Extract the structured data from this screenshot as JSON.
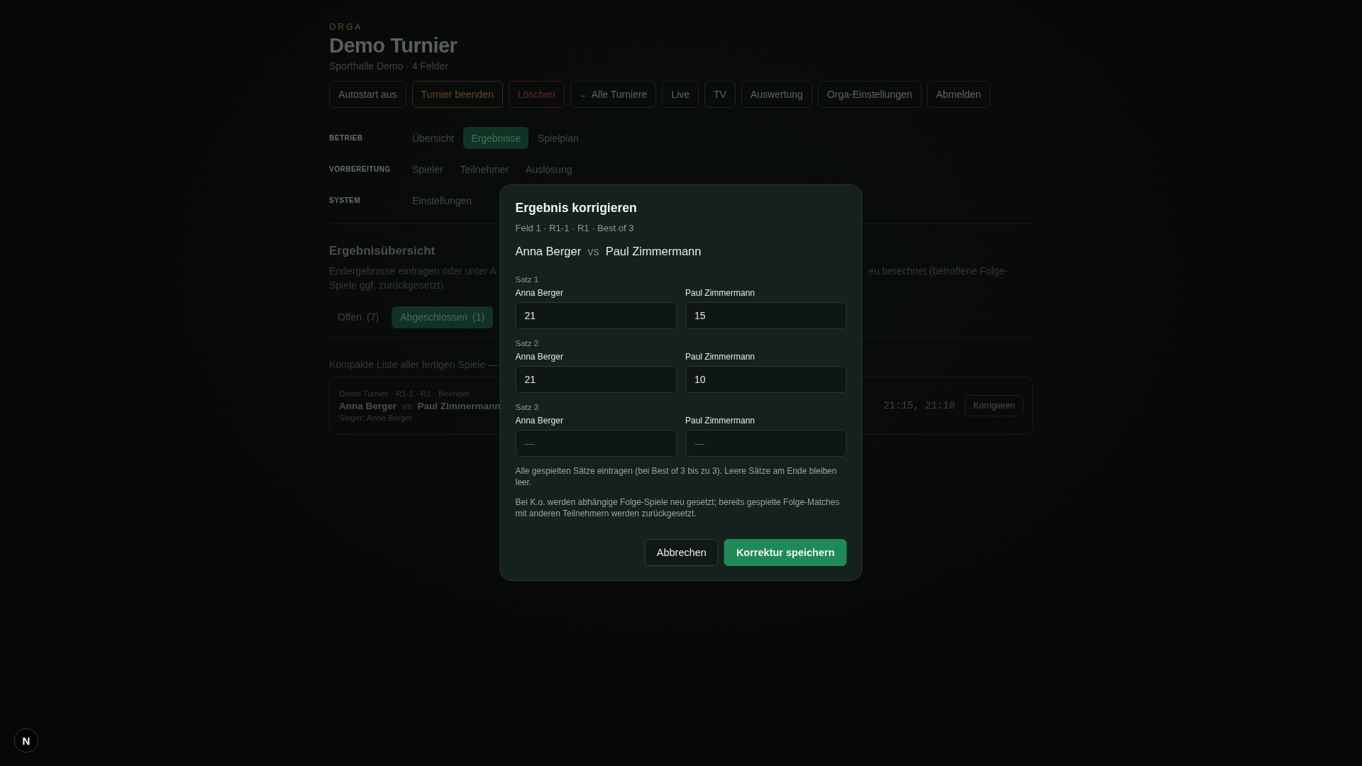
{
  "header": {
    "eyebrow": "ORGA",
    "title": "Demo Turnier",
    "subtitle": "Sporthalle Demo · 4 Felder"
  },
  "actions": [
    {
      "label": "Autostart aus",
      "kind": "default"
    },
    {
      "label": "Turnier beenden",
      "kind": "warning"
    },
    {
      "label": "Löschen",
      "kind": "danger"
    },
    {
      "label": "← Alle Turniere",
      "kind": "default"
    },
    {
      "label": "Live",
      "kind": "default"
    },
    {
      "label": "TV",
      "kind": "default"
    },
    {
      "label": "Auswertung",
      "kind": "default"
    },
    {
      "label": "Orga-Einstellungen",
      "kind": "default"
    },
    {
      "label": "Abmelden",
      "kind": "default"
    }
  ],
  "nav": [
    {
      "section": "BETRIEB",
      "items": [
        {
          "label": "Übersicht",
          "selected": false
        },
        {
          "label": "Ergebnisse",
          "selected": true
        },
        {
          "label": "Spielplan",
          "selected": false
        }
      ]
    },
    {
      "section": "VORBEREITUNG",
      "items": [
        {
          "label": "Spieler",
          "selected": false
        },
        {
          "label": "Teilnehmer",
          "selected": false
        },
        {
          "label": "Auslosung",
          "selected": false
        }
      ]
    },
    {
      "section": "SYSTEM",
      "items": [
        {
          "label": "Einstellungen",
          "selected": false
        }
      ]
    }
  ],
  "section": {
    "title": "Ergebnisübersicht",
    "description_left": [
      "Endergebnisse eintragen oder unter A",
      "Spiele ggf. zurückgesetzt)."
    ],
    "description_right": "eu berechnet (betroffene Folge-"
  },
  "filter_tabs": [
    {
      "label": "Offen",
      "count": "(7)",
      "selected": false
    },
    {
      "label": "Abgeschlossen",
      "count": "(1)",
      "selected": true
    }
  ],
  "list_intro": "Kompakte Liste aller fertigen Spiele —",
  "matches": [
    {
      "meta": "Demo Turnier · R1-1 · R1 · Beendet",
      "player_1": "Anna Berger",
      "vs": "vs",
      "player_2": "Paul Zimmermann",
      "winner": "Sieger: Anna Berger",
      "scores": "21:15, 21:10",
      "action": "Korrigieren"
    }
  ],
  "dialog": {
    "title": "Ergebnis korrigieren",
    "meta": "Feld 1 · R1-1 · R1 · Best of 3",
    "player_1": "Anna Berger",
    "vs": "vs",
    "player_2": "Paul Zimmermann",
    "sets": [
      {
        "label": "Satz 1",
        "fields": [
          {
            "label": "Anna Berger",
            "value": "21"
          },
          {
            "label": "Paul Zimmermann",
            "value": "15"
          }
        ]
      },
      {
        "label": "Satz 2",
        "fields": [
          {
            "label": "Anna Berger",
            "value": "21"
          },
          {
            "label": "Paul Zimmermann",
            "value": "10"
          }
        ]
      },
      {
        "label": "Satz 3",
        "fields": [
          {
            "label": "Anna Berger",
            "placeholder": "—"
          },
          {
            "label": "Paul Zimmermann",
            "placeholder": "—"
          }
        ]
      }
    ],
    "notes": [
      "Alle gespielten Sätze eintragen (bei Best of 3 bis zu 3). Leere Sätze am Ende bleiben leer.",
      "Bei K.o. werden abhängige Folge-Spiele neu gesetzt; bereits gespielte Folge-Matches mit anderen Teilnehmern werden zurückgesetzt."
    ],
    "buttons": [
      {
        "label": "Abbrechen",
        "kind": "secondary"
      },
      {
        "label": "Korrektur speichern",
        "kind": "primary"
      }
    ]
  },
  "dev_badge": {
    "label": "N"
  }
}
